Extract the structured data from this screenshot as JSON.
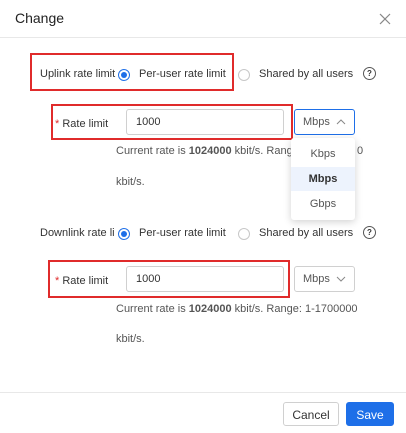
{
  "dialog": {
    "title": "Change",
    "close_icon": "close-icon"
  },
  "uplink": {
    "label": "Uplink rate limit",
    "options": [
      "Per-user rate limit",
      "Shared by all users"
    ],
    "selected": "Per-user rate limit"
  },
  "uplink_rate": {
    "label": "Rate limit",
    "value": "1000",
    "unit": "Mbps",
    "hint_prefix": "Current rate is ",
    "hint_value": "1024000",
    "hint_suffix": " kbit/s. Range: 1-1700000",
    "hint_suffix_visible": " kbit/s. Rang",
    "hint_tail": "0",
    "hint_line2": "kbit/s."
  },
  "unit_dropdown": {
    "options": [
      "Kbps",
      "Mbps",
      "Gbps"
    ],
    "selected": "Mbps"
  },
  "downlink": {
    "label": "Downlink rate limit",
    "label_visible": "Downlink rate li",
    "options": [
      "Per-user rate limit",
      "Shared by all users"
    ],
    "selected": "Per-user rate limit"
  },
  "downlink_rate": {
    "label": "Rate limit",
    "value": "1000",
    "unit": "Mbps",
    "hint_prefix": "Current rate is ",
    "hint_value": "1024000",
    "hint_suffix": " kbit/s. Range: 1-1700000",
    "hint_line2": "kbit/s."
  },
  "footer": {
    "cancel_label": "Cancel",
    "save_label": "Save"
  },
  "colors": {
    "accent": "#1e6fe8",
    "highlight_box": "#e02b2b"
  }
}
